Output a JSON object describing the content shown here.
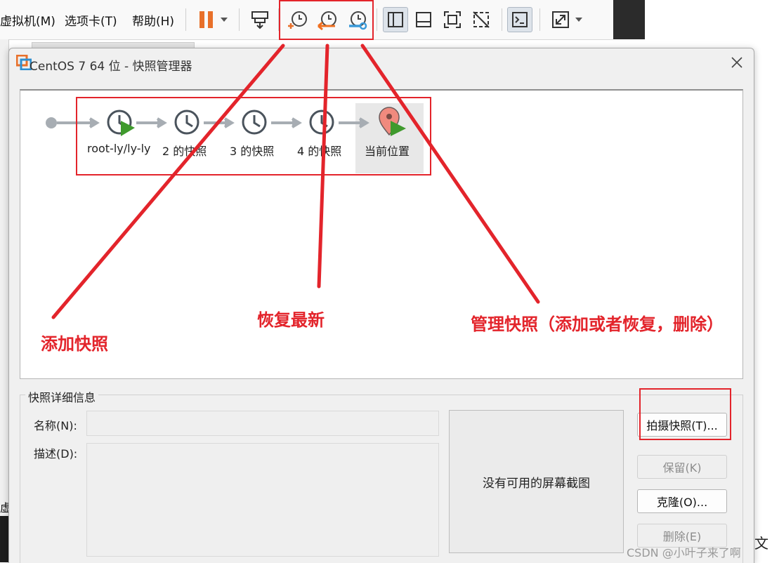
{
  "menu": [
    "虚拟机(M)",
    "选项卡(T)",
    "帮助(H)"
  ],
  "left_strip_text": "虚拟",
  "dialog": {
    "title": "CentOS 7 64 位 - 快照管理器"
  },
  "snapshots": [
    {
      "label": "root-ly/ly-ly"
    },
    {
      "label": "2 的快照"
    },
    {
      "label": "3 的快照"
    },
    {
      "label": "4 的快照"
    },
    {
      "label": "当前位置"
    }
  ],
  "details": {
    "title": "快照详细信息",
    "name_label": "名称(N):",
    "name_value": "",
    "desc_label": "描述(D):",
    "desc_value": "",
    "no_screenshot": "没有可用的屏幕截图"
  },
  "buttons": {
    "take": "拍摄快照(T)...",
    "keep": "保留(K)",
    "clone": "克隆(O)...",
    "delete": "删除(E)"
  },
  "annotations": {
    "add": "添加快照",
    "restore": "恢复最新",
    "manage": "管理快照（添加或者恢复，删除）"
  },
  "watermark": "CSDN @小叶子来了啊",
  "right_tail": "文",
  "colors": {
    "annotation_red": "#e3242b",
    "pause_orange": "#e8702a",
    "restore_orange": "#f07020",
    "manage_blue": "#3a9ad9",
    "play_green": "#3f9a2d",
    "location_pin": "#f08a7e"
  }
}
